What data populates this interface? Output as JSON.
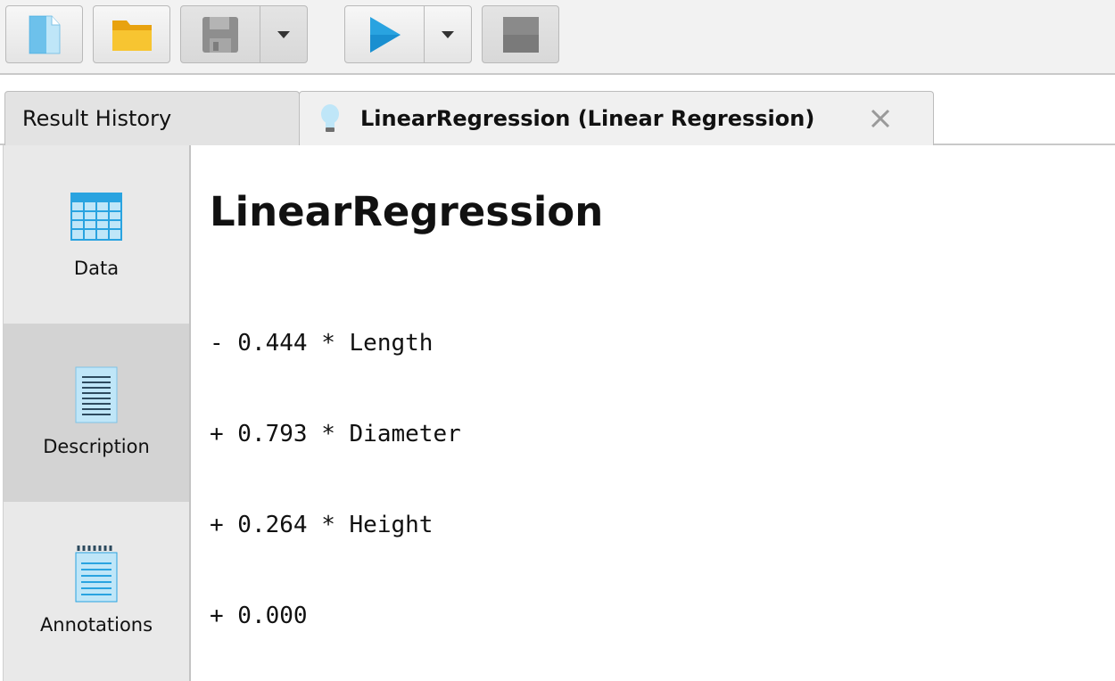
{
  "toolbar": {
    "buttons": [
      {
        "icon": "new-file-icon",
        "enabled": true
      },
      {
        "icon": "open-folder-icon",
        "enabled": true
      },
      {
        "icon": "save-icon",
        "enabled": false,
        "has_dropdown": true
      },
      {
        "icon": "run-icon",
        "enabled": true,
        "has_dropdown": true
      },
      {
        "icon": "stop-icon",
        "enabled": false
      }
    ]
  },
  "tabs": {
    "history_label": "Result History",
    "active_label": "LinearRegression (Linear Regression)",
    "active_icon": "lightbulb-icon"
  },
  "sidebar": {
    "items": [
      {
        "label": "Data",
        "icon": "table-icon",
        "selected": false
      },
      {
        "label": "Description",
        "icon": "document-icon",
        "selected": true
      },
      {
        "label": "Annotations",
        "icon": "notepad-icon",
        "selected": false
      }
    ]
  },
  "main": {
    "title": "LinearRegression",
    "model_lines": [
      "- 0.444 * Length",
      "+ 0.793 * Diameter",
      "+ 0.264 * Height",
      "+ 0.000"
    ]
  },
  "colors": {
    "accent_blue": "#29a3e0",
    "folder_yellow": "#f5b916",
    "selected_sidebar": "#d3d3d3"
  }
}
